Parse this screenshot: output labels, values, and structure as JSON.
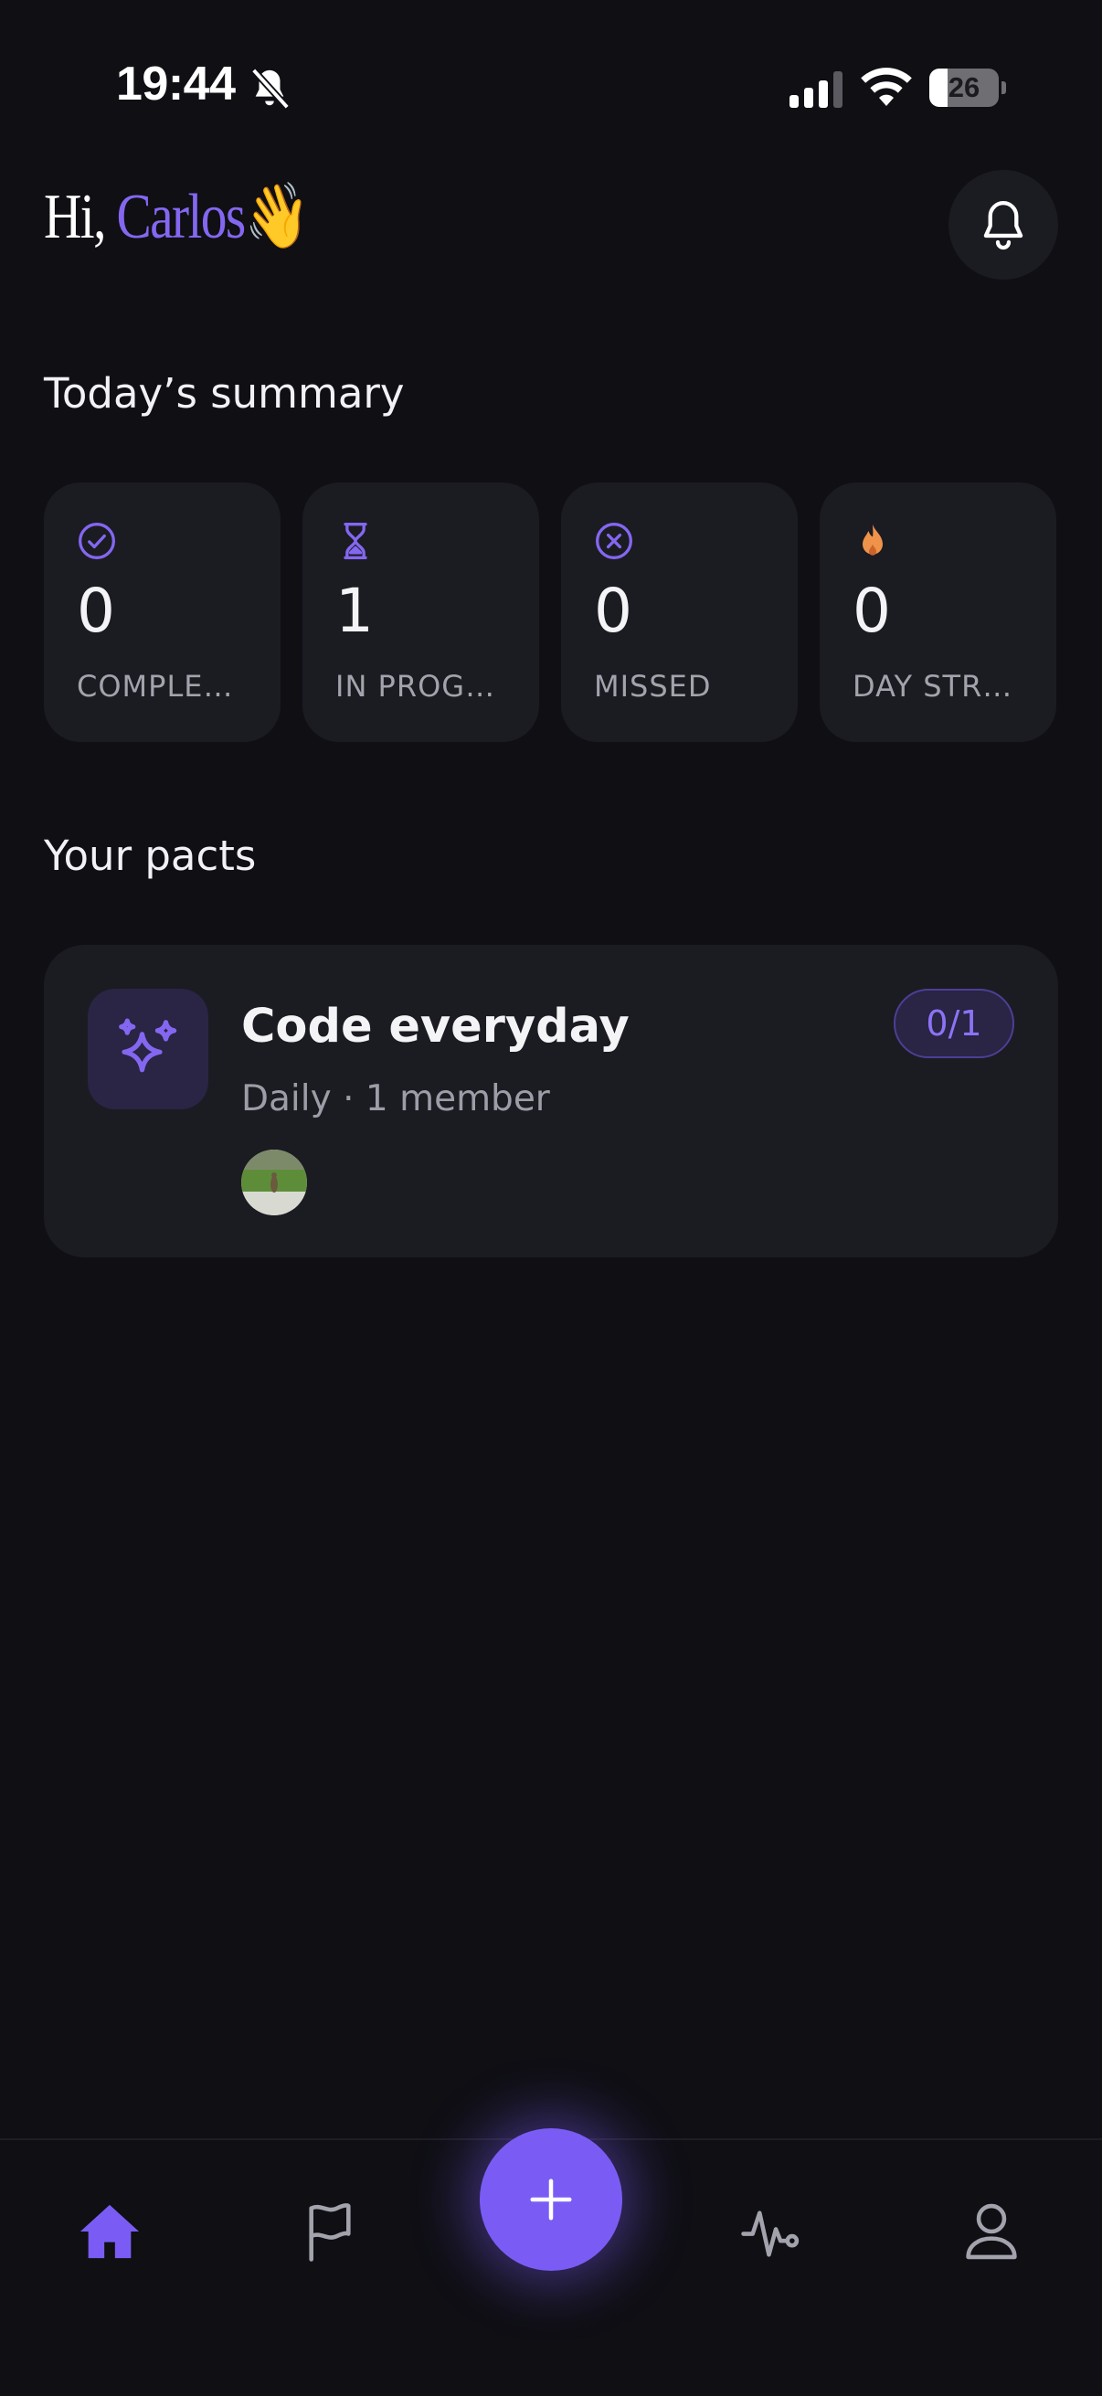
{
  "status_bar": {
    "time": "19:44",
    "battery_level": "26"
  },
  "header": {
    "greeting_prefix": "Hi, ",
    "user_name": "Carlos",
    "greeting_emoji": "👋",
    "bell_icon": "bell-icon"
  },
  "summary": {
    "title": "Today’s summary",
    "stats": [
      {
        "icon": "check-circle-icon",
        "value": "0",
        "label": "COMPLE…",
        "icon_color": "#8467f0"
      },
      {
        "icon": "hourglass-icon",
        "value": "1",
        "label": "IN PROG…",
        "icon_color": "#8467f0"
      },
      {
        "icon": "x-circle-icon",
        "value": "0",
        "label": "MISSED",
        "icon_color": "#8467f0"
      },
      {
        "icon": "flame-icon",
        "value": "0",
        "label": "DAY STR…",
        "icon_color": "#f0934a"
      }
    ]
  },
  "pacts": {
    "title": "Your pacts",
    "items": [
      {
        "icon": "sparkles-icon",
        "title": "Code everyday",
        "meta": "Daily · 1 member",
        "progress": "0/1"
      }
    ]
  },
  "bottom_nav": {
    "items": [
      "home-icon",
      "flag-icon",
      "add-icon",
      "activity-icon",
      "profile-icon"
    ],
    "active": "home-icon",
    "accent": "#7a5cf5"
  }
}
